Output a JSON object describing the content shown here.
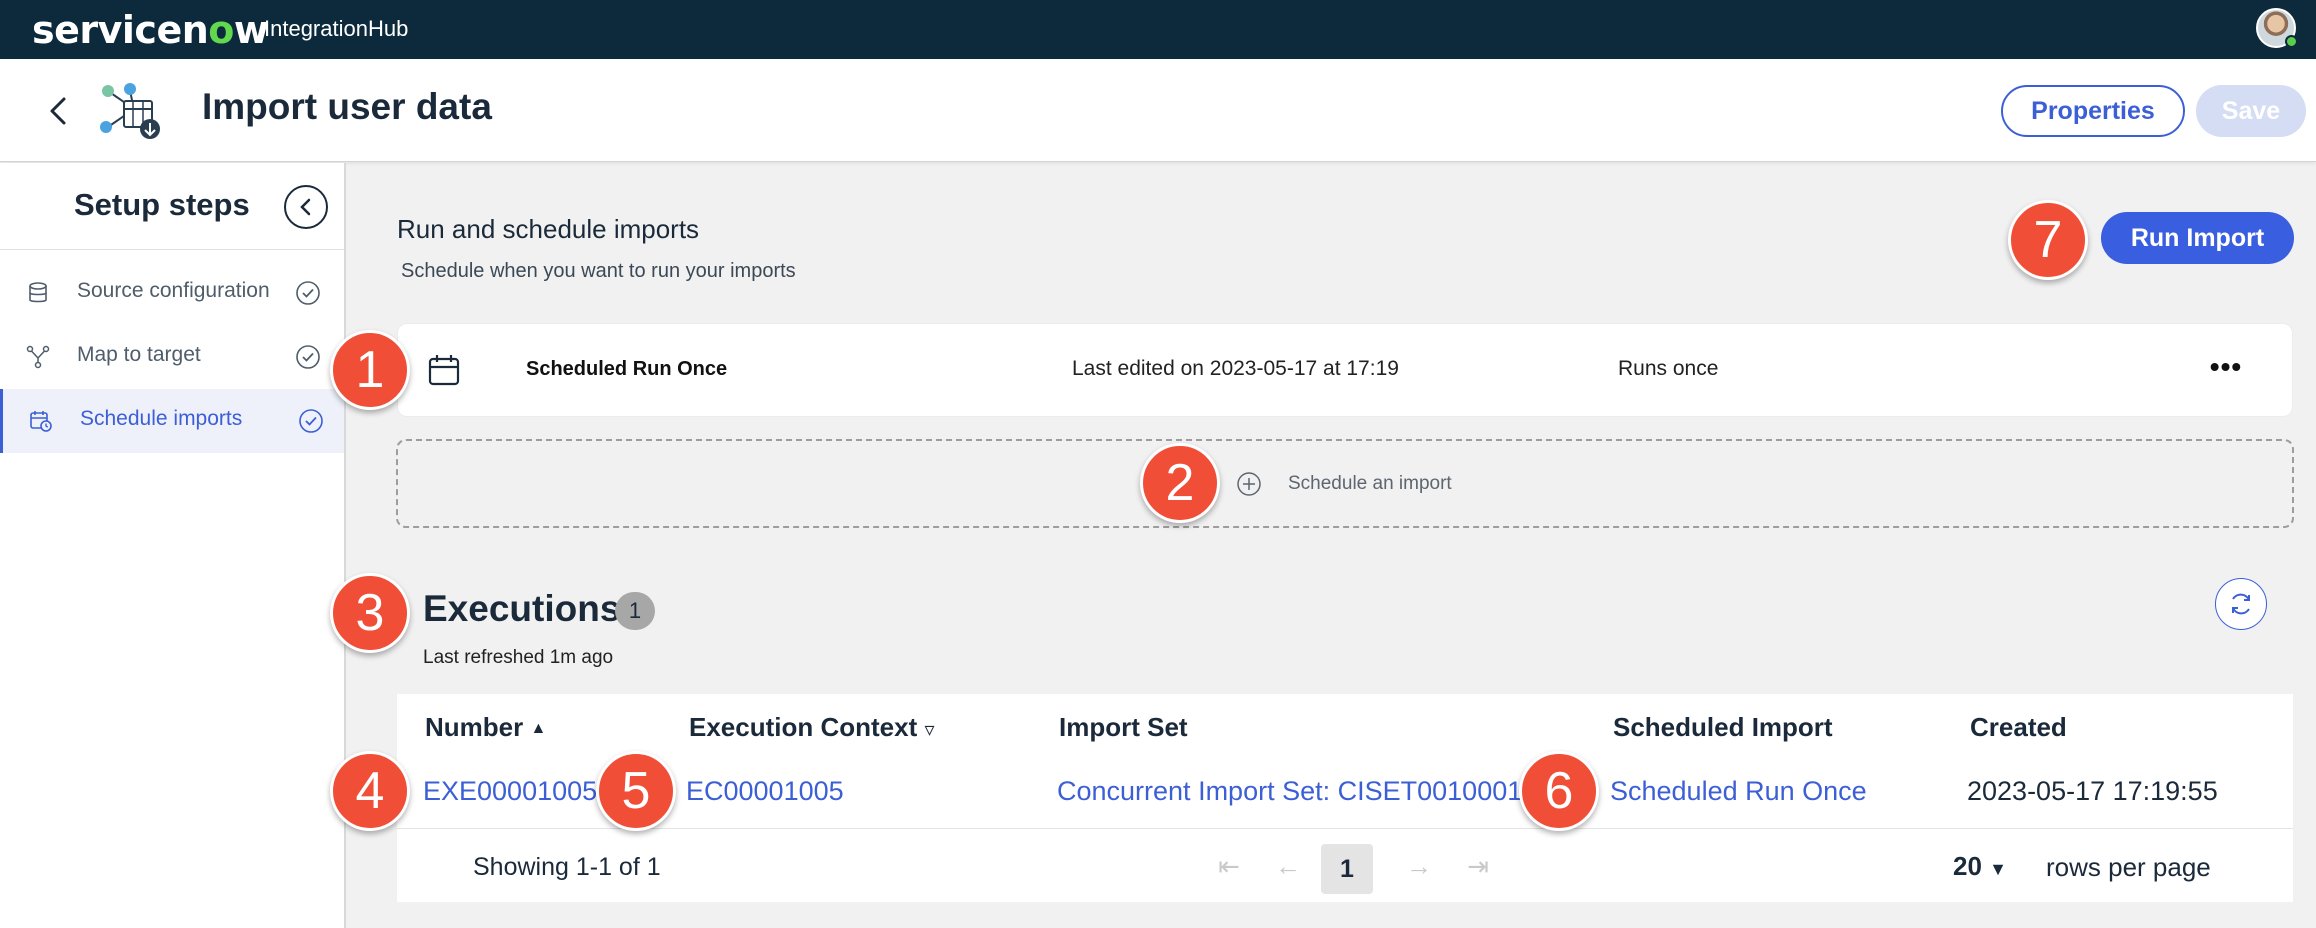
{
  "topbar": {
    "brand_prefix": "servicen",
    "brand_o": "o",
    "brand_suffix": "w",
    "product": "IntegrationHub"
  },
  "header": {
    "title": "Import user data",
    "properties_label": "Properties",
    "save_label": "Save"
  },
  "sidebar": {
    "title": "Setup steps",
    "steps": [
      {
        "label": "Source configuration",
        "icon": "database-icon",
        "active": false,
        "complete": true
      },
      {
        "label": "Map to target",
        "icon": "merge-icon",
        "active": false,
        "complete": true
      },
      {
        "label": "Schedule imports",
        "icon": "calendar-clock-icon",
        "active": true,
        "complete": true
      }
    ]
  },
  "main": {
    "title": "Run and schedule imports",
    "subtitle": "Schedule when you want to run your imports",
    "run_import_label": "Run Import",
    "schedule": {
      "name": "Scheduled Run Once",
      "edited": "Last edited on 2023-05-17 at 17:19",
      "frequency": "Runs once"
    },
    "add_schedule_label": "Schedule an import",
    "executions": {
      "title": "Executions",
      "count": "1",
      "last_refreshed": "Last refreshed 1m ago",
      "columns": [
        "Number",
        "Execution Context",
        "Import Set",
        "Scheduled Import",
        "Created"
      ],
      "rows": [
        {
          "number": "EXE00001005",
          "context": "EC00001005",
          "import_set": "Concurrent Import Set: CISET0010001",
          "scheduled_import": "Scheduled Run Once",
          "created": "2023-05-17 17:19:55"
        }
      ],
      "showing": "Showing 1-1 of 1",
      "current_page": "1",
      "rows_per_page": "20",
      "rows_per_page_label": "rows per page"
    }
  },
  "markers": [
    "1",
    "2",
    "3",
    "4",
    "5",
    "6",
    "7"
  ],
  "colors": {
    "topbar": "#0c2a3b",
    "accent": "#3c5fd6",
    "brand_green": "#62d84e",
    "marker": "#f04e37"
  }
}
